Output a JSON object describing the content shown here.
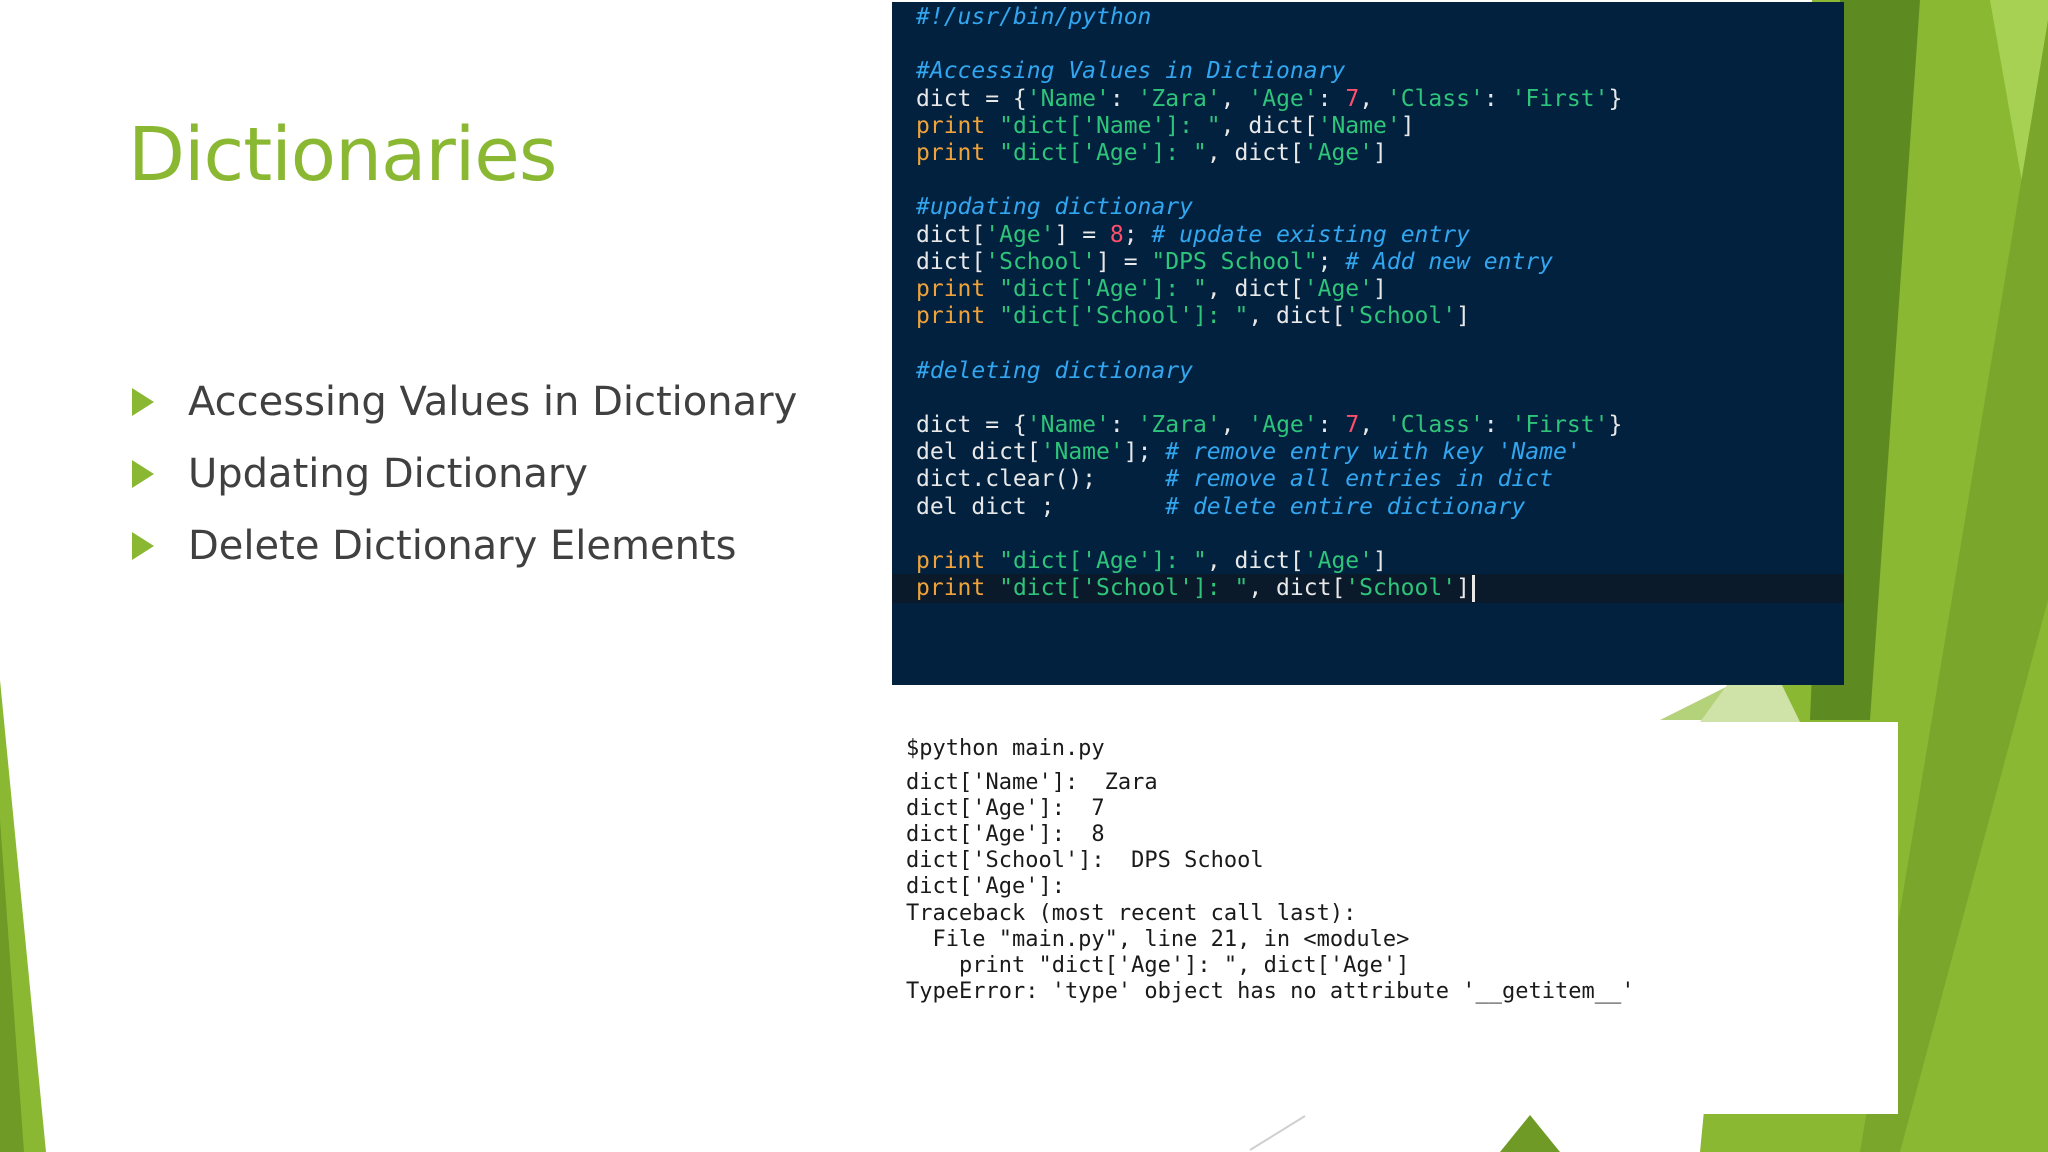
{
  "slide": {
    "title": "Dictionaries",
    "bullets": [
      "Accessing Values in Dictionary",
      "Updating Dictionary",
      "Delete Dictionary Elements"
    ]
  },
  "colors": {
    "accent_green": "#8ab833",
    "code_bg": "#01213f",
    "keyword": "#f0a33a",
    "string": "#2ec47a",
    "number": "#ff4f6d",
    "comment": "#33a6f0",
    "identifier": "#e8e8e8"
  },
  "code_panel": {
    "lines": [
      [
        {
          "t": "#!/usr/bin/python",
          "c": "cm"
        }
      ],
      [],
      [
        {
          "t": "#Accessing Values in Dictionary",
          "c": "cm"
        }
      ],
      [
        {
          "t": "dict = {",
          "c": "id"
        },
        {
          "t": "'Name'",
          "c": "str"
        },
        {
          "t": ": ",
          "c": "id"
        },
        {
          "t": "'Zara'",
          "c": "str"
        },
        {
          "t": ", ",
          "c": "id"
        },
        {
          "t": "'Age'",
          "c": "str"
        },
        {
          "t": ": ",
          "c": "id"
        },
        {
          "t": "7",
          "c": "num"
        },
        {
          "t": ", ",
          "c": "id"
        },
        {
          "t": "'Class'",
          "c": "str"
        },
        {
          "t": ": ",
          "c": "id"
        },
        {
          "t": "'First'",
          "c": "str"
        },
        {
          "t": "}",
          "c": "id"
        }
      ],
      [
        {
          "t": "print ",
          "c": "kw"
        },
        {
          "t": "\"dict['Name']: \"",
          "c": "str"
        },
        {
          "t": ", dict[",
          "c": "id"
        },
        {
          "t": "'Name'",
          "c": "str"
        },
        {
          "t": "]",
          "c": "id"
        }
      ],
      [
        {
          "t": "print ",
          "c": "kw"
        },
        {
          "t": "\"dict['Age']: \"",
          "c": "str"
        },
        {
          "t": ", dict[",
          "c": "id"
        },
        {
          "t": "'Age'",
          "c": "str"
        },
        {
          "t": "]",
          "c": "id"
        }
      ],
      [],
      [
        {
          "t": "#updating dictionary",
          "c": "cm"
        }
      ],
      [
        {
          "t": "dict[",
          "c": "id"
        },
        {
          "t": "'Age'",
          "c": "str"
        },
        {
          "t": "] = ",
          "c": "id"
        },
        {
          "t": "8",
          "c": "num"
        },
        {
          "t": "; ",
          "c": "id"
        },
        {
          "t": "# update existing entry",
          "c": "cm"
        }
      ],
      [
        {
          "t": "dict[",
          "c": "id"
        },
        {
          "t": "'School'",
          "c": "str"
        },
        {
          "t": "] = ",
          "c": "id"
        },
        {
          "t": "\"DPS School\"",
          "c": "str"
        },
        {
          "t": "; ",
          "c": "id"
        },
        {
          "t": "# Add new entry",
          "c": "cm"
        }
      ],
      [
        {
          "t": "print ",
          "c": "kw"
        },
        {
          "t": "\"dict['Age']: \"",
          "c": "str"
        },
        {
          "t": ", dict[",
          "c": "id"
        },
        {
          "t": "'Age'",
          "c": "str"
        },
        {
          "t": "]",
          "c": "id"
        }
      ],
      [
        {
          "t": "print ",
          "c": "kw"
        },
        {
          "t": "\"dict['School']: \"",
          "c": "str"
        },
        {
          "t": ", dict[",
          "c": "id"
        },
        {
          "t": "'School'",
          "c": "str"
        },
        {
          "t": "]",
          "c": "id"
        }
      ],
      [],
      [
        {
          "t": "#deleting dictionary",
          "c": "cm"
        }
      ],
      [],
      [
        {
          "t": "dict = {",
          "c": "id"
        },
        {
          "t": "'Name'",
          "c": "str"
        },
        {
          "t": ": ",
          "c": "id"
        },
        {
          "t": "'Zara'",
          "c": "str"
        },
        {
          "t": ", ",
          "c": "id"
        },
        {
          "t": "'Age'",
          "c": "str"
        },
        {
          "t": ": ",
          "c": "id"
        },
        {
          "t": "7",
          "c": "num"
        },
        {
          "t": ", ",
          "c": "id"
        },
        {
          "t": "'Class'",
          "c": "str"
        },
        {
          "t": ": ",
          "c": "id"
        },
        {
          "t": "'First'",
          "c": "str"
        },
        {
          "t": "}",
          "c": "id"
        }
      ],
      [
        {
          "t": "del dict[",
          "c": "id"
        },
        {
          "t": "'Name'",
          "c": "str"
        },
        {
          "t": "]; ",
          "c": "id"
        },
        {
          "t": "# remove entry with key 'Name'",
          "c": "cm"
        }
      ],
      [
        {
          "t": "dict.clear();     ",
          "c": "id"
        },
        {
          "t": "# remove all entries in dict",
          "c": "cm"
        }
      ],
      [
        {
          "t": "del dict ;        ",
          "c": "id"
        },
        {
          "t": "# delete entire dictionary",
          "c": "cm"
        }
      ],
      [],
      [
        {
          "t": "print ",
          "c": "kw"
        },
        {
          "t": "\"dict['Age']: \"",
          "c": "str"
        },
        {
          "t": ", dict[",
          "c": "id"
        },
        {
          "t": "'Age'",
          "c": "str"
        },
        {
          "t": "]",
          "c": "id"
        }
      ],
      [
        {
          "t": "print ",
          "c": "kw"
        },
        {
          "t": "\"dict['School']: \"",
          "c": "str"
        },
        {
          "t": ", dict[",
          "c": "id"
        },
        {
          "t": "'School'",
          "c": "str"
        },
        {
          "t": "]",
          "c": "id"
        }
      ]
    ]
  },
  "output_panel": {
    "lines": [
      "$python main.py",
      "dict['Name']:  Zara",
      "dict['Age']:  7",
      "dict['Age']:  8",
      "dict['School']:  DPS School",
      "dict['Age']:",
      "Traceback (most recent call last):",
      "  File \"main.py\", line 21, in <module>",
      "    print \"dict['Age']: \", dict['Age']",
      "TypeError: 'type' object has no attribute '__getitem__'"
    ]
  }
}
